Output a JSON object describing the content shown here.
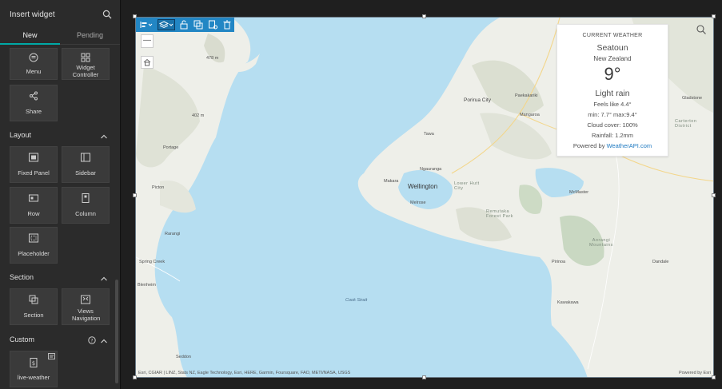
{
  "panel": {
    "title": "Insert widget",
    "tabs": {
      "new": "New",
      "pending": "Pending"
    },
    "widgets_top": [
      {
        "label": "Menu",
        "icon": "menu-icon"
      },
      {
        "label": "Widget Controller",
        "icon": "widget-controller-icon"
      },
      {
        "label": "Share",
        "icon": "share-icon"
      }
    ],
    "layout": {
      "title": "Layout",
      "items": [
        {
          "label": "Fixed Panel",
          "icon": "fixed-panel-icon"
        },
        {
          "label": "Sidebar",
          "icon": "sidebar-icon"
        },
        {
          "label": "Row",
          "icon": "row-icon"
        },
        {
          "label": "Column",
          "icon": "column-icon"
        },
        {
          "label": "Placeholder",
          "icon": "placeholder-icon"
        }
      ]
    },
    "section": {
      "title": "Section",
      "items": [
        {
          "label": "Section",
          "icon": "section-icon"
        },
        {
          "label": "Views Navigation",
          "icon": "views-navigation-icon"
        }
      ]
    },
    "custom": {
      "title": "Custom",
      "items": [
        {
          "label": "live-weather",
          "icon": "live-weather-icon"
        }
      ]
    }
  },
  "map": {
    "places": {
      "wellington": "Wellington",
      "porirua": "Porirua City",
      "tawa": "Tawa",
      "ngauranga": "Ngauranga",
      "makara": "Makara",
      "melrose": "Melrose",
      "lower_hutt": "Lower Hutt City",
      "portage": "Portage",
      "picton": "Picton",
      "rarangi": "Rarangi",
      "spring_creek": "Spring Creek",
      "blenheim": "Blenheim",
      "seddon": "Seddon",
      "cook_strait": "Cook Strait",
      "paekakariki": "Paekakariki",
      "mangaroa": "Mangaroa",
      "gladstone": "Gladstone",
      "carterton": "Carterton District",
      "mcmaster": "McMaster",
      "aorangi": "Aorangi Mountains",
      "kawakawa": "Kawakawa",
      "pirinoa": "Pirinoa",
      "dandale": "Dandale",
      "remutaka": "Remutaka Forest Park",
      "elev_478": "478 m",
      "elev_402": "402 m"
    },
    "attribution": "Esri, CGIAR | LINZ, Stats NZ, Eagle Technology, Esri, HERE, Garmin, Foursquare, FAO, METI/NASA, USGS",
    "powered_by": "Powered by Esri",
    "zoom_out": "—"
  },
  "weather": {
    "caption": "CURRENT WEATHER",
    "city": "Seatoun",
    "country": "New Zealand",
    "temp": "9°",
    "condition": "Light rain",
    "feels_like": "Feels like 4.4°",
    "min_max": "min: 7.7° max:9.4°",
    "cloud": "Cloud cover: 100%",
    "rain": "Rainfall: 1.2mm",
    "powered_prefix": "Powered by ",
    "powered_link": "WeatherAPI.com"
  },
  "colors": {
    "accent": "#00a9a6",
    "toolbar": "#2286c4",
    "water": "#b6def1",
    "land": "#eeefe9"
  }
}
